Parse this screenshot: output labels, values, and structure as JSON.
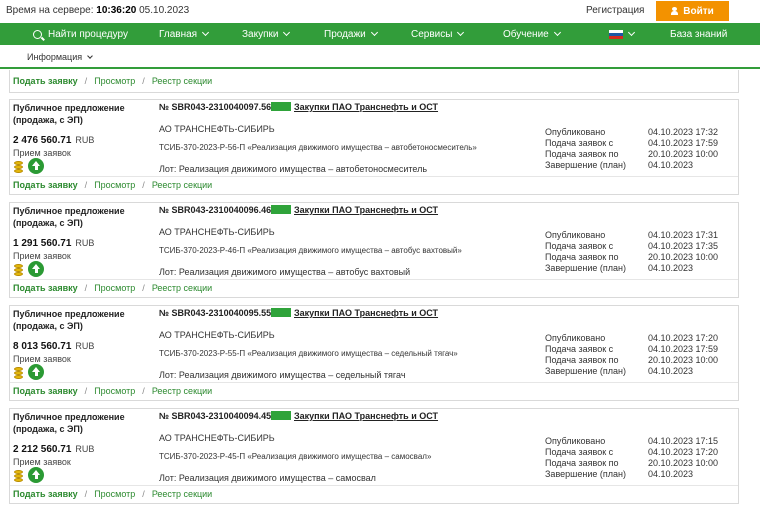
{
  "header": {
    "server_time_label": "Время на сервере:",
    "server_time": "10:36:20",
    "server_date": "05.10.2023",
    "register_label": "Регистрация",
    "login_label": "Войти"
  },
  "nav": {
    "find_label": "Найти процедуру",
    "items": [
      "Главная",
      "Закупки",
      "Продажи",
      "Сервисы",
      "Обучение"
    ],
    "knowledge_label": "База знаний",
    "flag_colors": [
      "#ffffff",
      "#1c57a5",
      "#d52b1e"
    ]
  },
  "subnav": {
    "info_label": "Информация"
  },
  "actions": {
    "apply_label": "Подать заявку",
    "view_label": "Просмотр",
    "registry_label": "Реестр секции",
    "separator": "/"
  },
  "labels": {
    "published": "Опубликовано",
    "apply_from": "Подача заявок с",
    "apply_to": "Подача заявок по",
    "completion": "Завершение (план)"
  },
  "procedures": [
    {
      "type": "Публичное предложение (продажа, с ЭП)",
      "number": "№ SBR043-2310040097.56",
      "organizer": "Закупки ПАО Транснефть и ОСТ",
      "customer": "АО ТРАНСНЕФТЬ-СИБИРЬ",
      "subject": "ТСИБ-370-2023-Р-56-П «Реализация движимого имущества – автобетоносмеситель»",
      "lot": "Лот: Реализация движимого имущества – автобетоносмеситель",
      "price": "2 476 560.71",
      "currency": "RUB",
      "status": "Прием заявок",
      "published": "04.10.2023 17:32",
      "apply_from": "04.10.2023 17:59",
      "apply_to": "20.10.2023 10:00",
      "completion": "04.10.2023"
    },
    {
      "type": "Публичное предложение (продажа, с ЭП)",
      "number": "№ SBR043-2310040096.46",
      "organizer": "Закупки ПАО Транснефть и ОСТ",
      "customer": "АО ТРАНСНЕФТЬ-СИБИРЬ",
      "subject": "ТСИБ-370-2023-Р-46-П «Реализация движимого имущества – автобус вахтовый»",
      "lot": "Лот: Реализация движимого имущества – автобус вахтовый",
      "price": "1 291 560.71",
      "currency": "RUB",
      "status": "Прием заявок",
      "published": "04.10.2023 17:31",
      "apply_from": "04.10.2023 17:35",
      "apply_to": "20.10.2023 10:00",
      "completion": "04.10.2023"
    },
    {
      "type": "Публичное предложение (продажа, с ЭП)",
      "number": "№ SBR043-2310040095.55",
      "organizer": "Закупки ПАО Транснефть и ОСТ",
      "customer": "АО ТРАНСНЕФТЬ-СИБИРЬ",
      "subject": "ТСИБ-370-2023-Р-55-П «Реализация движимого имущества – седельный тягач»",
      "lot": "Лот: Реализация движимого имущества – седельный тягач",
      "price": "8 013 560.71",
      "currency": "RUB",
      "status": "Прием заявок",
      "published": "04.10.2023 17:20",
      "apply_from": "04.10.2023 17:59",
      "apply_to": "20.10.2023 10:00",
      "completion": "04.10.2023"
    },
    {
      "type": "Публичное предложение (продажа, с ЭП)",
      "number": "№ SBR043-2310040094.45",
      "organizer": "Закупки ПАО Транснефть и ОСТ",
      "customer": "АО ТРАНСНЕФТЬ-СИБИРЬ",
      "subject": "ТСИБ-370-2023-Р-45-П «Реализация движимого имущества – самосвал»",
      "lot": "Лот: Реализация движимого имущества – самосвал",
      "price": "2 212 560.71",
      "currency": "RUB",
      "status": "Прием заявок",
      "published": "04.10.2023 17:15",
      "apply_from": "04.10.2023 17:20",
      "apply_to": "20.10.2023 10:00",
      "completion": "04.10.2023"
    }
  ]
}
